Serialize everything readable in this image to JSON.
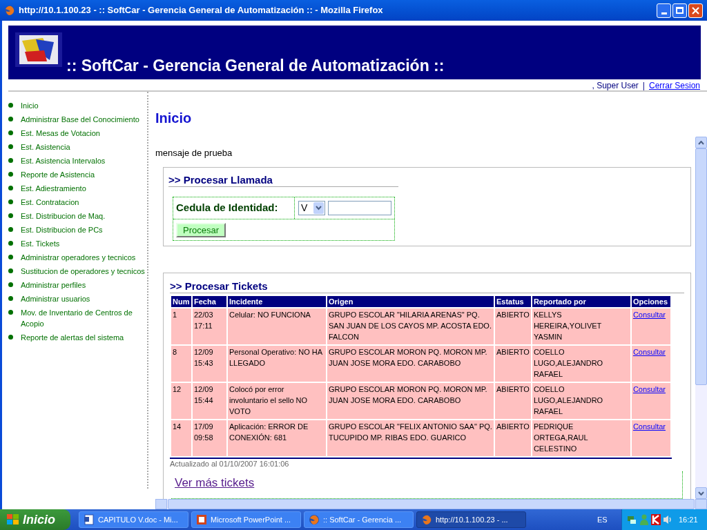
{
  "window": {
    "title": "http://10.1.100.23 - :: SoftCar - Gerencia General de Automatización :: - Mozilla Firefox"
  },
  "header": {
    "title": ":: SoftCar - Gerencia General de Automatización ::"
  },
  "user_bar": {
    "user": ", Super User",
    "separator": "|",
    "logout": "Cerrar Sesion"
  },
  "sidebar": {
    "items": [
      {
        "label": "Inicio"
      },
      {
        "label": "Administrar Base del Conocimiento"
      },
      {
        "label": "Est. Mesas de Votacion"
      },
      {
        "label": "Est. Asistencia"
      },
      {
        "label": "Est. Asistencia Intervalos"
      },
      {
        "label": "Reporte de Asistencia"
      },
      {
        "label": "Est. Adiestramiento"
      },
      {
        "label": "Est. Contratacion"
      },
      {
        "label": "Est. Distribucion de Maq."
      },
      {
        "label": "Est. Distribucion de PCs"
      },
      {
        "label": "Est. Tickets"
      },
      {
        "label": "Administrar operadores y tecnicos"
      },
      {
        "label": "Sustitucion de operadores y tecnicos"
      },
      {
        "label": "Administrar perfiles"
      },
      {
        "label": "Administrar usuarios"
      },
      {
        "label": "Mov. de Inventario de Centros de Acopio"
      },
      {
        "label": "Reporte de alertas del sistema"
      }
    ]
  },
  "main": {
    "heading": "Inicio",
    "message": "mensaje de prueba"
  },
  "call_panel": {
    "title": ">> Procesar Llamada",
    "field_label": "Cedula de Identidad:",
    "select_value": "V",
    "button": "Procesar"
  },
  "tickets_panel": {
    "title": ">> Procesar Tickets",
    "columns": [
      "Num",
      "Fecha",
      "Incidente",
      "Origen",
      "Estatus",
      "Reportado por",
      "Opciones"
    ],
    "rows": [
      {
        "cells": [
          "1",
          "22/03 17:11",
          "Celular: NO FUNCIONA",
          "GRUPO ESCOLAR \"HILARIA ARENAS\" PQ. SAN JUAN DE LOS CAYOS MP. ACOSTA EDO. FALCON",
          "ABIERTO",
          "KELLYS HEREIRA,YOLIVET YASMIN"
        ],
        "link": "Consultar"
      },
      {
        "cells": [
          "8",
          "12/09 15:43",
          "Personal Operativo: NO HA LLEGADO",
          "GRUPO ESCOLAR MORON PQ. MORON MP. JUAN JOSE MORA EDO. CARABOBO",
          "ABIERTO",
          "COELLO LUGO,ALEJANDRO RAFAEL"
        ],
        "link": "Consultar"
      },
      {
        "cells": [
          "12",
          "12/09 15:44",
          "Colocó por error involuntario el sello NO VOTO",
          "GRUPO ESCOLAR MORON PQ. MORON MP. JUAN JOSE MORA EDO. CARABOBO",
          "ABIERTO",
          "COELLO LUGO,ALEJANDRO RAFAEL"
        ],
        "link": "Consultar"
      },
      {
        "cells": [
          "14",
          "17/09 09:58",
          "Aplicación: ERROR DE CONEXIÓN: 681",
          "GRUPO ESCOLAR \"FELIX ANTONIO SAA\" PQ. TUCUPIDO MP. RIBAS EDO. GUARICO",
          "ABIERTO",
          "PEDRIQUE ORTEGA,RAUL CELESTINO"
        ],
        "link": "Consultar"
      }
    ],
    "updated": "Actualizado al 01/10/2007 16:01:06",
    "more_link": "Ver más tickets"
  },
  "taskbar": {
    "start": "Inicio",
    "tasks": [
      {
        "label": "CAPITULO V.doc - Mi...",
        "kind": "word",
        "selected": false
      },
      {
        "label": "Microsoft PowerPoint ...",
        "kind": "powerpoint",
        "selected": false
      },
      {
        "label": ":: SoftCar - Gerencia ...",
        "kind": "firefox",
        "selected": false
      },
      {
        "label": "http://10.1.100.23 - ...",
        "kind": "firefox",
        "selected": true
      }
    ],
    "language": "ES",
    "clock": "16:21"
  }
}
